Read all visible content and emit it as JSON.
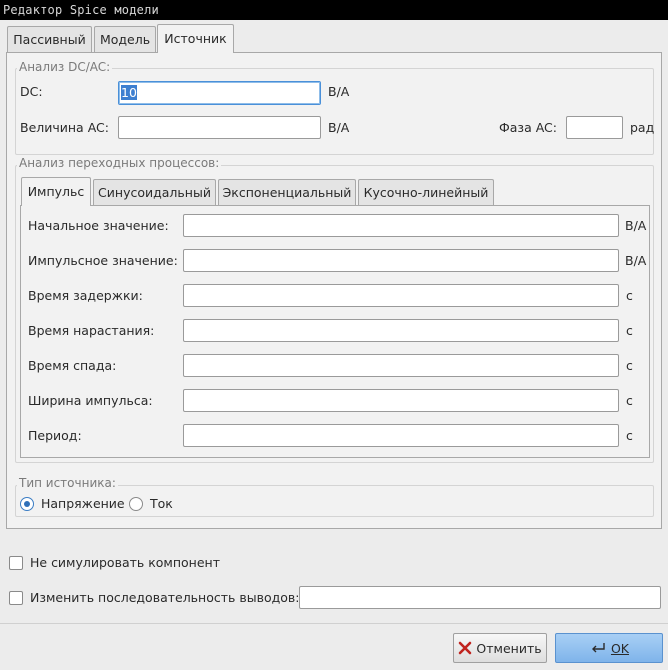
{
  "window": {
    "title": "Редактор Spice модели"
  },
  "main_tabs": [
    {
      "label": "Пассивный"
    },
    {
      "label": "Модель"
    },
    {
      "label": "Источник"
    }
  ],
  "dcac": {
    "group_label": "Анализ DC/AC:",
    "dc_label": "DC:",
    "dc_value": "10",
    "dc_unit": "В/А",
    "ac_label": "Величина AC:",
    "ac_value": "",
    "ac_unit": "В/А",
    "phase_label": "Фаза AC:",
    "phase_value": "",
    "phase_unit": "рад"
  },
  "transient": {
    "group_label": "Анализ переходных процессов:",
    "tabs": [
      {
        "label": "Импульс"
      },
      {
        "label": "Синусоидальный"
      },
      {
        "label": "Экспоненциальный"
      },
      {
        "label": "Кусочно-линейный"
      }
    ],
    "rows": [
      {
        "label": "Начальное значение:",
        "value": "",
        "unit": "В/А"
      },
      {
        "label": "Импульсное значение:",
        "value": "",
        "unit": "В/А"
      },
      {
        "label": "Время задержки:",
        "value": "",
        "unit": "с"
      },
      {
        "label": "Время нарастания:",
        "value": "",
        "unit": "с"
      },
      {
        "label": "Время спада:",
        "value": "",
        "unit": "с"
      },
      {
        "label": "Ширина импульса:",
        "value": "",
        "unit": "с"
      },
      {
        "label": "Период:",
        "value": "",
        "unit": "с"
      }
    ]
  },
  "source_type": {
    "group_label": "Тип источника:",
    "voltage_label": "Напряжение",
    "current_label": "Ток",
    "selected": "voltage"
  },
  "options": {
    "no_simulate_label": "Не симулировать компонент",
    "pin_order_label": "Изменить последовательность выводов:",
    "pin_order_value": ""
  },
  "buttons": {
    "cancel_label": "Отменить",
    "ok_label": "OK"
  },
  "colors": {
    "primary_button": "#7fb4ea",
    "radio_selected": "#2f6fb8",
    "selection": "#3d7fd0"
  }
}
